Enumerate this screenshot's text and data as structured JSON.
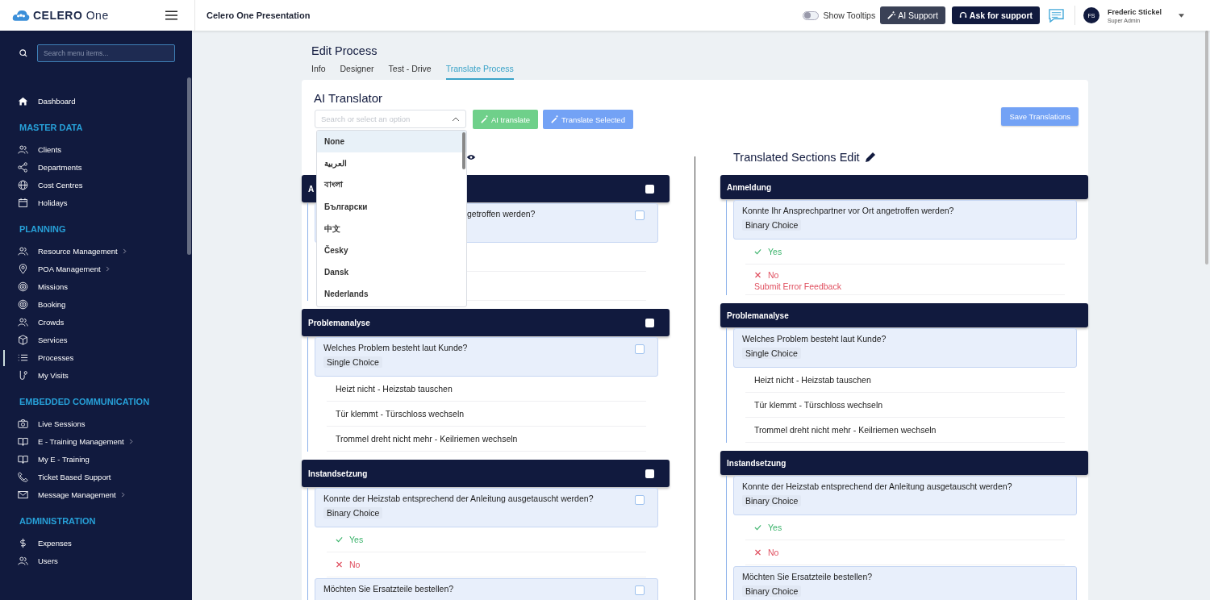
{
  "topbar": {
    "logo_text": "CELERO",
    "logo_suffix": "One",
    "project": "Celero One Presentation",
    "tooltips": {
      "label": "Show Tooltips",
      "on": false
    },
    "ai_support": "AI Support",
    "ask_support": "Ask for support",
    "user": {
      "initials": "FS",
      "name": "Frederic Stickel",
      "role": "Super Admin"
    }
  },
  "sidebar": {
    "search_placeholder": "Search menu items...",
    "groups": [
      {
        "items": [
          {
            "label": "Dashboard",
            "submenu": false,
            "selected": false
          }
        ]
      },
      {
        "heading": "MASTER DATA",
        "items": [
          {
            "label": "Clients",
            "submenu": false,
            "selected": false
          },
          {
            "label": "Departments",
            "submenu": false,
            "selected": false
          },
          {
            "label": "Cost Centres",
            "submenu": false,
            "selected": false
          },
          {
            "label": "Holidays",
            "submenu": false,
            "selected": false
          }
        ]
      },
      {
        "heading": "PLANNING",
        "items": [
          {
            "label": "Resource Management",
            "submenu": true,
            "selected": false
          },
          {
            "label": "POA Management",
            "submenu": true,
            "selected": false
          },
          {
            "label": "Missions",
            "submenu": false,
            "selected": false
          },
          {
            "label": "Booking",
            "submenu": false,
            "selected": false
          },
          {
            "label": "Crowds",
            "submenu": false,
            "selected": false
          },
          {
            "label": "Services",
            "submenu": false,
            "selected": false
          },
          {
            "label": "Processes",
            "submenu": false,
            "selected": true
          },
          {
            "label": "My Visits",
            "submenu": false,
            "selected": false
          }
        ]
      },
      {
        "heading": "EMBEDDED COMMUNICATION",
        "items": [
          {
            "label": "Live Sessions",
            "submenu": false,
            "selected": false
          },
          {
            "label": "E - Training Management",
            "submenu": true,
            "selected": false
          },
          {
            "label": "My E - Training",
            "submenu": false,
            "selected": false
          },
          {
            "label": "Ticket Based Support",
            "submenu": false,
            "selected": false
          },
          {
            "label": "Message Management",
            "submenu": true,
            "selected": false
          }
        ]
      },
      {
        "heading": "ADMINISTRATION",
        "items": [
          {
            "label": "Expenses",
            "submenu": false,
            "selected": false
          },
          {
            "label": "Users",
            "submenu": false,
            "selected": false
          }
        ]
      }
    ]
  },
  "page": {
    "title": "Edit Process",
    "tabs": [
      {
        "label": "Info",
        "selected": false
      },
      {
        "label": "Designer",
        "selected": false
      },
      {
        "label": "Test - Drive",
        "selected": false
      },
      {
        "label": "Translate Process",
        "selected": true
      }
    ]
  },
  "translator": {
    "title": "AI Translator",
    "select": {
      "placeholder": "Search or select an option",
      "open": true,
      "options": [
        {
          "label": "None",
          "selected": true
        },
        {
          "label": "العربية",
          "selected": false
        },
        {
          "label": "বাংলা",
          "selected": false
        },
        {
          "label": "Български",
          "selected": false
        },
        {
          "label": "中文",
          "selected": false
        },
        {
          "label": "Česky",
          "selected": false
        },
        {
          "label": "Dansk",
          "selected": false
        },
        {
          "label": "Nederlands",
          "selected": false
        }
      ]
    },
    "ai_translate": "AI translate",
    "translate_selected": "Translate Selected",
    "save": "Save Translations"
  },
  "original": {
    "sections": [
      {
        "title": "A",
        "checked": false,
        "questions": [
          {
            "text": "getroffen werden?",
            "checked": false
          }
        ]
      },
      {
        "title": "Problemanalyse",
        "checked": false,
        "questions": [
          {
            "text": "Welches Problem besteht laut Kunde?",
            "type": "Single Choice",
            "checked": false,
            "options": [
              {
                "kind": "choice",
                "label": "Heizt nicht - Heizstab tauschen"
              },
              {
                "kind": "choice",
                "label": "Tür klemmt - Türschloss wechseln"
              },
              {
                "kind": "choice",
                "label": "Trommel dreht nicht mehr - Keilriemen wechseln"
              }
            ]
          }
        ]
      },
      {
        "title": "Instandsetzung",
        "checked": false,
        "questions": [
          {
            "text": "Konnte der Heizstab entsprechend der Anleitung ausgetauscht werden?",
            "type": "Binary Choice",
            "checked": false,
            "options": [
              {
                "kind": "yes",
                "label": "Yes"
              },
              {
                "kind": "no",
                "label": "No"
              }
            ]
          },
          {
            "text": "Möchten Sie Ersatzteile bestellen?",
            "checked": false
          }
        ]
      }
    ]
  },
  "translated": {
    "title": "Translated Sections Edit",
    "sections": [
      {
        "title": "Anmeldung",
        "questions": [
          {
            "text": "Konnte Ihr Ansprechpartner vor Ort angetroffen werden?",
            "type": "Binary Choice",
            "options": [
              {
                "kind": "yes",
                "label": "Yes"
              },
              {
                "kind": "no",
                "label": "No",
                "feedback": "Submit Error Feedback"
              }
            ]
          }
        ]
      },
      {
        "title": "Problemanalyse",
        "questions": [
          {
            "text": "Welches Problem besteht laut Kunde?",
            "type": "Single Choice",
            "options": [
              {
                "kind": "choice",
                "label": "Heizt nicht - Heizstab tauschen"
              },
              {
                "kind": "choice",
                "label": "Tür klemmt - Türschloss wechseln"
              },
              {
                "kind": "choice",
                "label": "Trommel dreht nicht mehr - Keilriemen wechseln"
              }
            ]
          }
        ]
      },
      {
        "title": "Instandsetzung",
        "questions": [
          {
            "text": "Konnte der Heizstab entsprechend der Anleitung ausgetauscht werden?",
            "type": "Binary Choice",
            "options": [
              {
                "kind": "yes",
                "label": "Yes"
              },
              {
                "kind": "no",
                "label": "No"
              }
            ]
          },
          {
            "text": "Möchten Sie Ersatzteile bestellen?",
            "type": "Binary Choice"
          }
        ]
      }
    ]
  }
}
